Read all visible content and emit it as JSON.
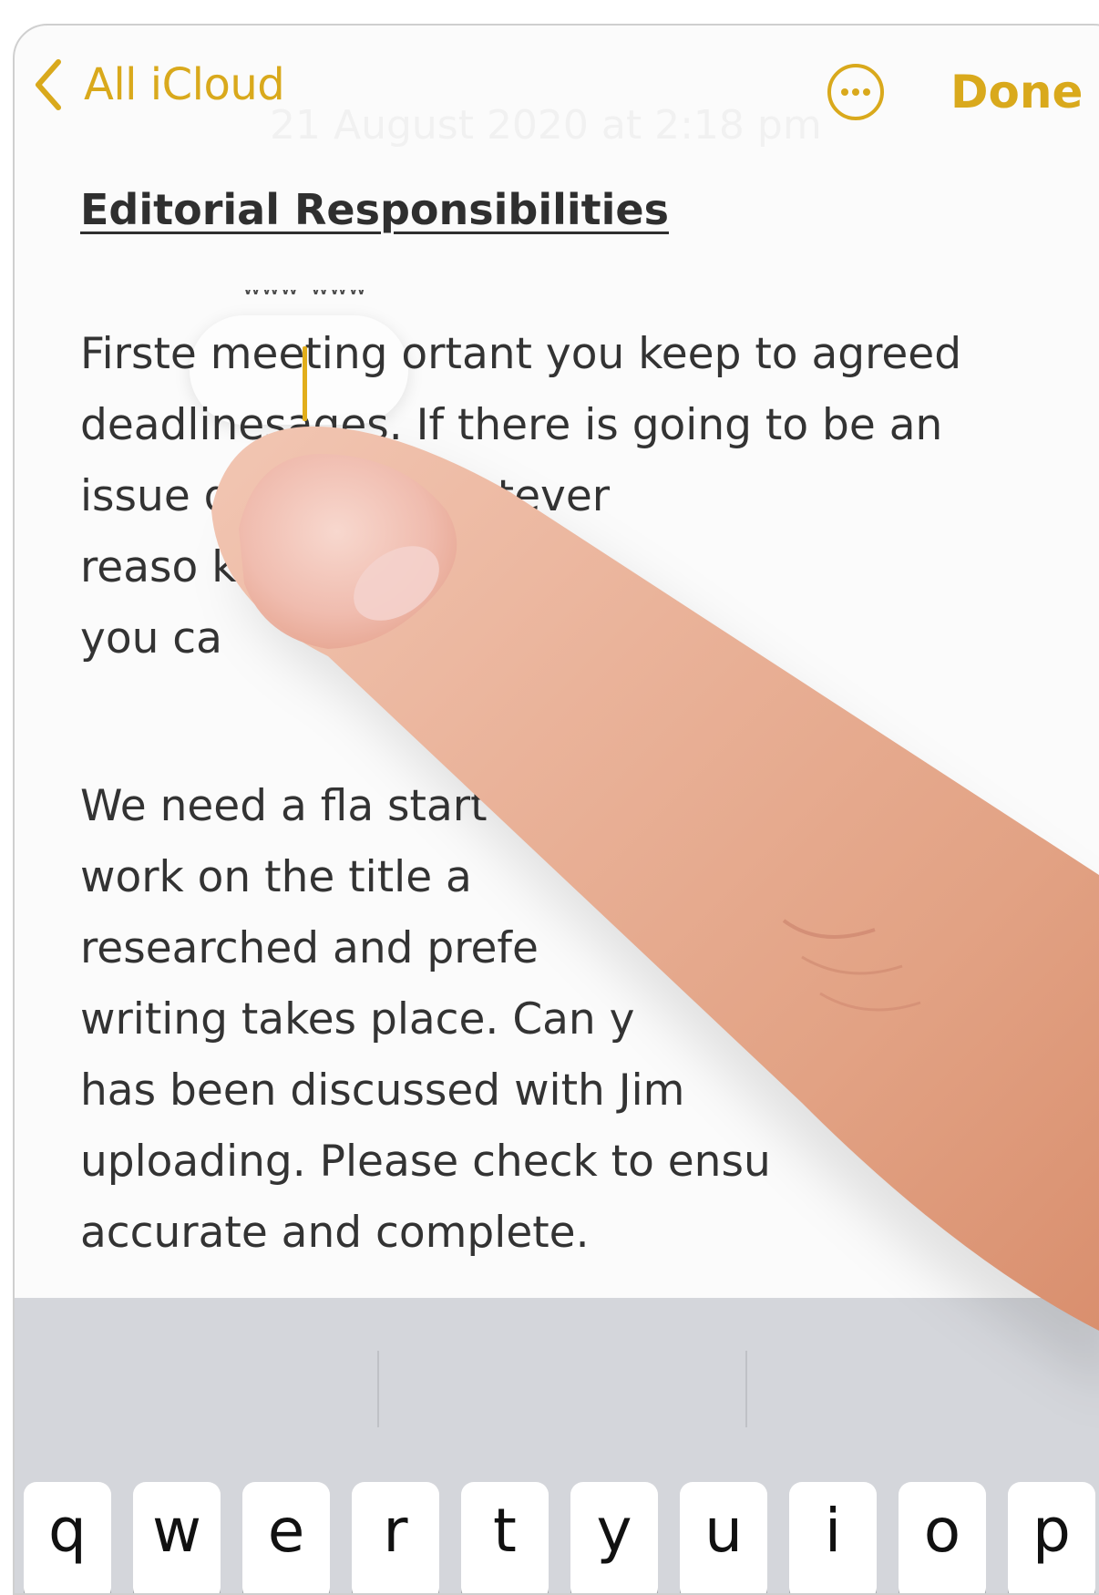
{
  "nav": {
    "back_label": "All iCloud",
    "date_text": "21 August 2020 at 2:18 pm",
    "done_label": "Done",
    "more_icon": "ellipsis-circle-icon",
    "accent_color": "#d9a91c"
  },
  "note": {
    "title": "Editorial Responsibilities",
    "paragraph1": [
      "Firste meeting ortant you keep to agreed",
      "deadlinesages. If there is going to be an",
      "issue          dates for whatever",
      "reaso                   know as soon as",
      "you ca"
    ],
    "paragraph2": [
      "We need a fla                             start",
      "work on the title a",
      "researched and prefe",
      "writing takes place. Can y",
      "has been discussed with Jim",
      "uploading. Please check to ensu",
      "accurate and complete."
    ]
  },
  "keyboard": {
    "row1": [
      "q",
      "w",
      "e",
      "r",
      "t",
      "y",
      "u",
      "i",
      "o",
      "p"
    ]
  }
}
